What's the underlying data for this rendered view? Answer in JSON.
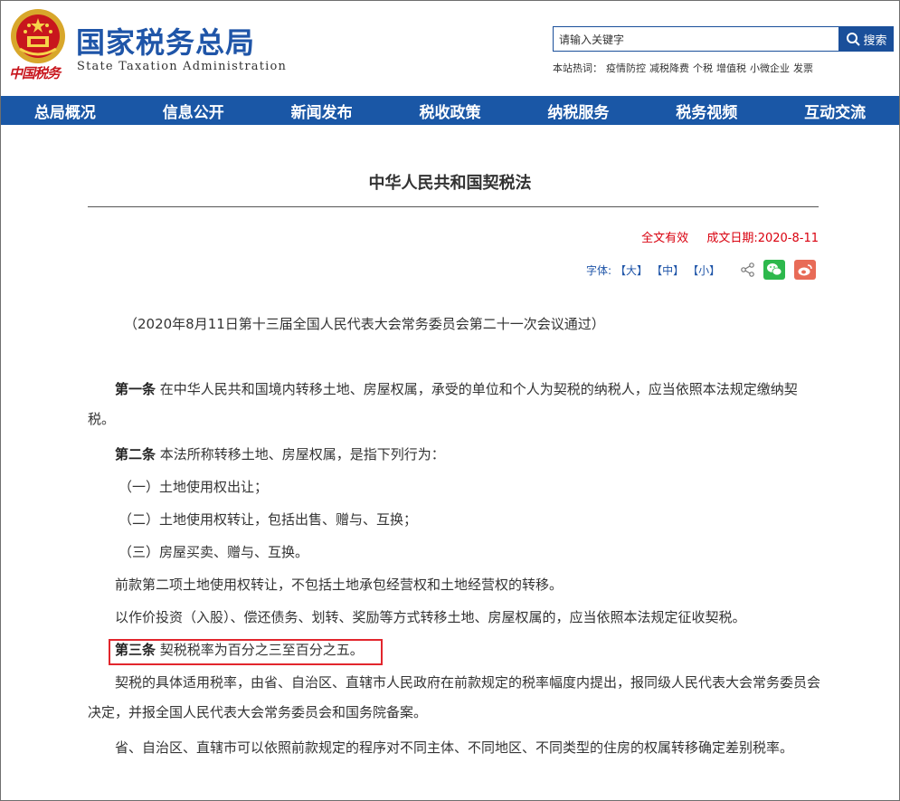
{
  "header": {
    "brand_script": "中国税务",
    "site_title": "国家税务总局",
    "site_subtitle": "State Taxation Administration",
    "search_value": "请输入关键字",
    "search_button": "搜索",
    "hotwords_label": "本站热词：",
    "hotwords": [
      "疫情防控",
      "减税降费",
      "个税",
      "增值税",
      "小微企业",
      "发票"
    ]
  },
  "nav": {
    "items": [
      "总局概况",
      "信息公开",
      "新闻发布",
      "税收政策",
      "纳税服务",
      "税务视频",
      "互动交流"
    ]
  },
  "article": {
    "title": "中华人民共和国契税法",
    "status": "全文有效",
    "date": "成文日期:2020-8-11",
    "font_label": "字体:",
    "size_large": "【大】",
    "size_medium": "【中】",
    "size_small": "【小】",
    "intro": "（2020年8月11日第十三届全国人民代表大会常务委员会第二十一次会议通过）",
    "art1_head": "第一条",
    "art1_text": " 在中华人民共和国境内转移土地、房屋权属，承受的单位和个人为契税的纳税人，应当依照本法规定缴纳契税。",
    "art2_head": "第二条",
    "art2_text": " 本法所称转移土地、房屋权属，是指下列行为：",
    "art2_item1": "（一）土地使用权出让；",
    "art2_item2": "（二）土地使用权转让，包括出售、赠与、互换；",
    "art2_item3": "（三）房屋买卖、赠与、互换。",
    "art2_p2": "前款第二项土地使用权转让，不包括土地承包经营权和土地经营权的转移。",
    "art2_p3": "以作价投资（入股）、偿还债务、划转、奖励等方式转移土地、房屋权属的，应当依照本法规定征收契税。",
    "art3_head": "第三条",
    "art3_text": " 契税税率为百分之三至百分之五。",
    "art3_p2": "契税的具体适用税率，由省、自治区、直辖市人民政府在前款规定的税率幅度内提出，报同级人民代表大会常务委员会决定，并报全国人民代表大会常务委员会和国务院备案。",
    "art3_p3": "省、自治区、直辖市可以依照前款规定的程序对不同主体、不同地区、不同类型的住房的权属转移确定差别税率。"
  },
  "colors": {
    "brand_blue": "#1f55a8",
    "nav_blue": "#1a57a6",
    "highlight_red": "#e2262d",
    "status_red": "#d9000e"
  },
  "icons": [
    "emblem-icon",
    "search-icon",
    "share-icon",
    "wechat-icon",
    "weibo-icon"
  ]
}
